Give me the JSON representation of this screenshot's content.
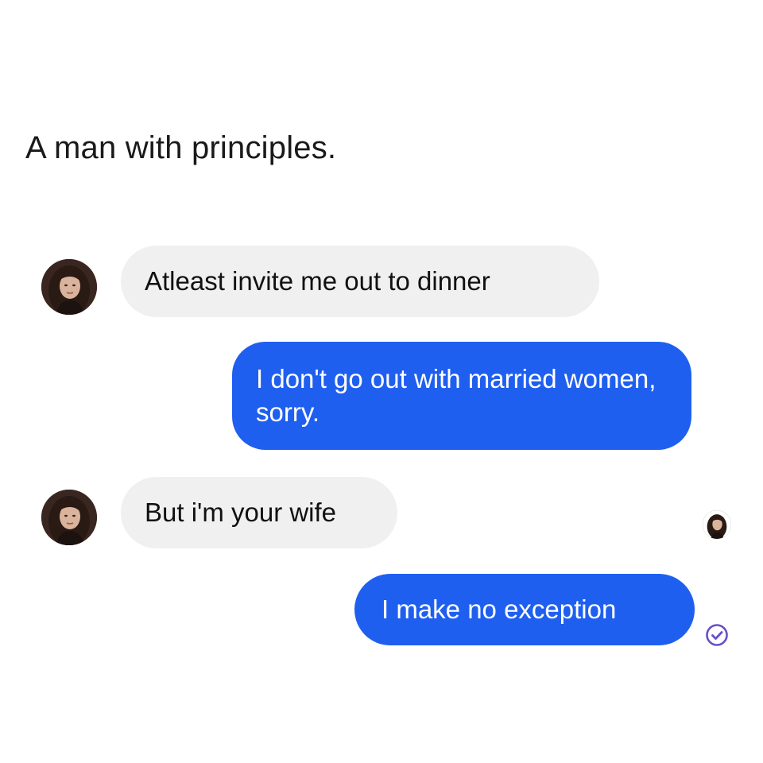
{
  "post": {
    "caption": "A man with principles."
  },
  "chat": {
    "messages": [
      {
        "direction": "incoming",
        "text": "Atleast invite me out to dinner"
      },
      {
        "direction": "outgoing",
        "text": "I don't go out with married women, sorry."
      },
      {
        "direction": "incoming",
        "text": "But i'm your wife"
      },
      {
        "direction": "outgoing",
        "text": "I make no exception"
      }
    ],
    "contact_avatar_icon": "woman-portrait-avatar",
    "seen_avatar_icon": "seen-receipt-avatar",
    "status_icon": "delivered-check-icon"
  },
  "colors": {
    "incoming_bubble": "#f0f0f0",
    "outgoing_bubble": "#1f5ff0",
    "check_color": "#6a4fc8"
  }
}
